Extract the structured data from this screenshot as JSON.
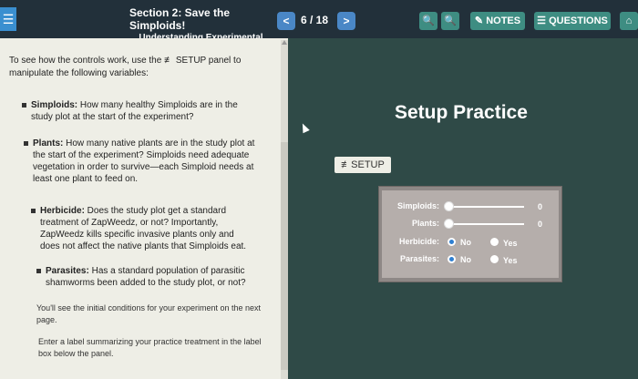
{
  "header": {
    "menu_icon": "☰",
    "title": "Section 2: Save the Simploids!",
    "subtitle": "Understanding Experimental Design",
    "page_indicator": "6 / 18",
    "prev_label": "<",
    "next_label": ">",
    "zoom_out_label": "🔍",
    "zoom_in_label": "🔍",
    "notes_label": "NOTES",
    "questions_label": "QUESTIONS"
  },
  "content": {
    "intro": "To see how the controls work, use the ≢ SETUP panel to manipulate the following variables:",
    "items": [
      {
        "term": "Simploids:",
        "text": " How many healthy Simploids are in the study plot at the start of the experiment?"
      },
      {
        "term": "Plants:",
        "text": " How many native plants are in the study plot at the start of the experiment? Simploids need adequate vegetation in order to survive—each Simploid needs at least one plant to feed on."
      },
      {
        "term": "Herbicide:",
        "text": " Does the study plot get a standard treatment of ZapWeedz, or not? Importantly, ZapWeedz kills specific invasive plants only and does not affect the native plants that Simploids eat."
      },
      {
        "term": "Parasites:",
        "text": " Has a standard population of parasitic shamworms been added to the study plot, or not?"
      }
    ],
    "note1": "You'll see the initial conditions for your experiment on the next page.",
    "note2": "Enter a label summarizing your practice treatment in the label box below the panel."
  },
  "panel": {
    "title": "Setup Practice",
    "badge": "≢SETUP",
    "simploids_label": "Simploids:",
    "simploids_value": "0",
    "plants_label": "Plants:",
    "plants_value": "0",
    "herbicide_label": "Herbicide:",
    "parasites_label": "Parasites:",
    "no_label": "No",
    "yes_label": "Yes"
  }
}
